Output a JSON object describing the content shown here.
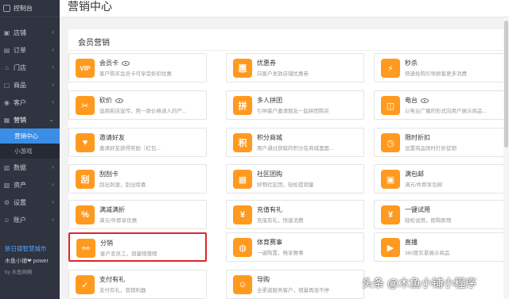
{
  "sidebar": {
    "top": "控制台",
    "items": [
      {
        "icon": "store-icon",
        "glyph": "▣",
        "label": "店铺"
      },
      {
        "icon": "order-icon",
        "glyph": "▤",
        "label": "订单"
      },
      {
        "icon": "shop-icon",
        "glyph": "⌂",
        "label": "门店"
      },
      {
        "icon": "goods-icon",
        "glyph": "▢",
        "label": "商品"
      },
      {
        "icon": "customer-icon",
        "glyph": "◉",
        "label": "客户"
      },
      {
        "icon": "marketing-icon",
        "glyph": "▦",
        "label": "营销"
      }
    ],
    "sub_items": [
      "营销中心",
      "小游戏"
    ],
    "items2": [
      {
        "icon": "data-icon",
        "glyph": "▥",
        "label": "数据"
      },
      {
        "icon": "assets-icon",
        "glyph": "▧",
        "label": "资产"
      },
      {
        "icon": "settings-icon",
        "glyph": "⚙",
        "label": "设置"
      },
      {
        "icon": "account-icon",
        "glyph": "☺",
        "label": "账户"
      }
    ],
    "promo": {
      "line1": "新日德智慧城市",
      "line2": "木鱼小铺❤ power",
      "line3": "by 木鱼网络"
    }
  },
  "header": {
    "title": "营销中心"
  },
  "panel": {
    "section_title": "会员营销"
  },
  "cards": [
    {
      "name": "会员卡",
      "desc": "客户购买会员卡可享受折扣优惠",
      "glyph": "VIP",
      "icon": "vip-card-icon",
      "eye": true
    },
    {
      "name": "优惠券",
      "desc": "向客户发放店铺优惠券",
      "glyph": "惠",
      "icon": "coupon-icon"
    },
    {
      "name": "秒杀",
      "desc": "快速抢购引导顾客更多消费",
      "glyph": "⚡",
      "icon": "flash-sale-icon"
    },
    {
      "name": "砍价",
      "desc": "选用新店宣传，用一款价格诱人的产...",
      "glyph": "✂",
      "icon": "bargain-icon",
      "eye": true
    },
    {
      "name": "多人拼团",
      "desc": "引导客户邀请朋友一起拼团购买",
      "glyph": "拼",
      "icon": "group-buy-icon"
    },
    {
      "name": "电台",
      "desc": "以电台广播的形式向用户展示商品...",
      "glyph": "◫",
      "icon": "radio-icon",
      "eye": true
    },
    {
      "name": "邀请好友",
      "desc": "邀请好友获得奖励（红包...",
      "glyph": "♥",
      "icon": "invite-friends-icon"
    },
    {
      "name": "积分商城",
      "desc": "用户通过获取的积分在商城里面...",
      "glyph": "积",
      "icon": "points-mall-icon"
    },
    {
      "name": "限时折扣",
      "desc": "设置商品限时打折促销",
      "glyph": "◷",
      "icon": "time-discount-icon"
    },
    {
      "name": "刮刮卡",
      "desc": "刮出刺激，刮出惊喜",
      "glyph": "刮",
      "icon": "scratch-card-icon"
    },
    {
      "name": "社区团购",
      "desc": "好物社区团，轻松提销量",
      "glyph": "▦",
      "icon": "community-group-icon"
    },
    {
      "name": "满包邮",
      "desc": "满元/件即享包邮",
      "glyph": "▣",
      "icon": "free-shipping-icon"
    },
    {
      "name": "满减满折",
      "desc": "满元/件即享优惠",
      "glyph": "%",
      "icon": "full-reduction-icon"
    },
    {
      "name": "充值有礼",
      "desc": "充值有礼，快速消费",
      "glyph": "¥",
      "icon": "recharge-gift-icon"
    },
    {
      "name": "一键试用",
      "desc": "轻松试用，即购即用",
      "glyph": "¥",
      "icon": "trial-icon"
    },
    {
      "name": "分销",
      "desc": "客户变员工，销量噌噌噌",
      "glyph": "⚯",
      "icon": "distribution-icon",
      "selected": true
    },
    {
      "name": "体育赛事",
      "desc": "一键购置，畅享赛事",
      "glyph": "◍",
      "icon": "sports-event-icon"
    },
    {
      "name": "直播",
      "desc": "360度实景展示商品",
      "glyph": "▶",
      "icon": "live-icon"
    },
    {
      "name": "支付有礼",
      "desc": "支付有礼，营销利器",
      "glyph": "✓",
      "icon": "pay-gift-icon"
    },
    {
      "name": "导购",
      "desc": "全渠道服务客户，销量再涨不停",
      "glyph": "☺",
      "icon": "shopping-guide-icon"
    },
    {
      "name": "",
      "desc": "",
      "glyph": "",
      "icon": "blank-icon",
      "hidden": true
    }
  ],
  "watermark": "头条 @木鱼小铺小程序"
}
